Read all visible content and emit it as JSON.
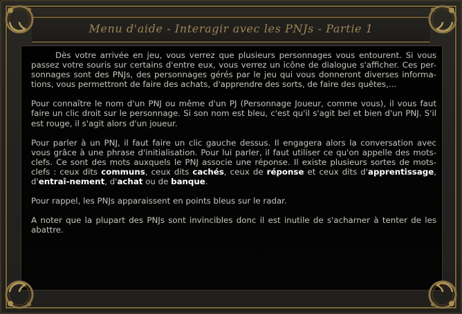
{
  "window": {
    "title": "Menu d'aide - Interagir avec les PNJs - Partie 1"
  },
  "content": {
    "p1": "Dès votre arrivée en jeu, vous verrez que plusieurs personnages vous entourent. Si vous passez votre souris sur certains d'entre eux, vous verrez un icône de dialogue s'afficher. Ces per-sonnages sont des PNJs, des personnages gérés par le jeu qui vous donneront diverses informa-tions, vous permettront de faire des achats, d'apprendre des sorts, de faire des quêtes,...",
    "p2": "Pour connaître le nom d'un PNJ ou même d'un PJ (Personnage Joueur, comme vous), il vous faut faire un clic droit sur le personnage. Si son nom est bleu, c'est qu'il s'agit bel et bien d'un PNJ. S'il est rouge, il s'agit alors d'un joueur.",
    "p3_intro": "Pour parler à un PNJ, il faut faire un clic gauche dessus. Il engagera alors la conversation avec vous grâce à une phrase d'initialisation. Pour lui parler, il faut utiliser ce qu'on appelle des mots-clefs. Ce sont des mots auxquels le PNJ associe une réponse. Il existe plusieurs sortes de mots-clefs : ceux dits ",
    "kw_communs": "communs",
    "sep_1": ", ceux dits ",
    "kw_caches": "cachés",
    "sep_2": ", ceux de ",
    "kw_reponse": "réponse",
    "sep_3": " et ceux dits d'",
    "kw_apprentissage": "apprentissage",
    "sep_4": ", d'",
    "kw_entrainement": "entraî-nement",
    "sep_5": ", d'",
    "kw_achat": "achat",
    "sep_6": " ou de ",
    "kw_banque": "banque",
    "sep_7": ".",
    "p4": "Pour rappel, les PNJs apparaissent en points bleus sur le radar.",
    "p5": "A noter que la plupart des PNJs sont invincibles donc il est inutile de s'acharner à tenter de les abattre."
  },
  "colors": {
    "frame_gold": "#7d6a3e",
    "title_text": "#9c8558",
    "body_text": "#c8c5bd",
    "keyword_text": "#ffffff",
    "panel_bg": "#030303"
  }
}
